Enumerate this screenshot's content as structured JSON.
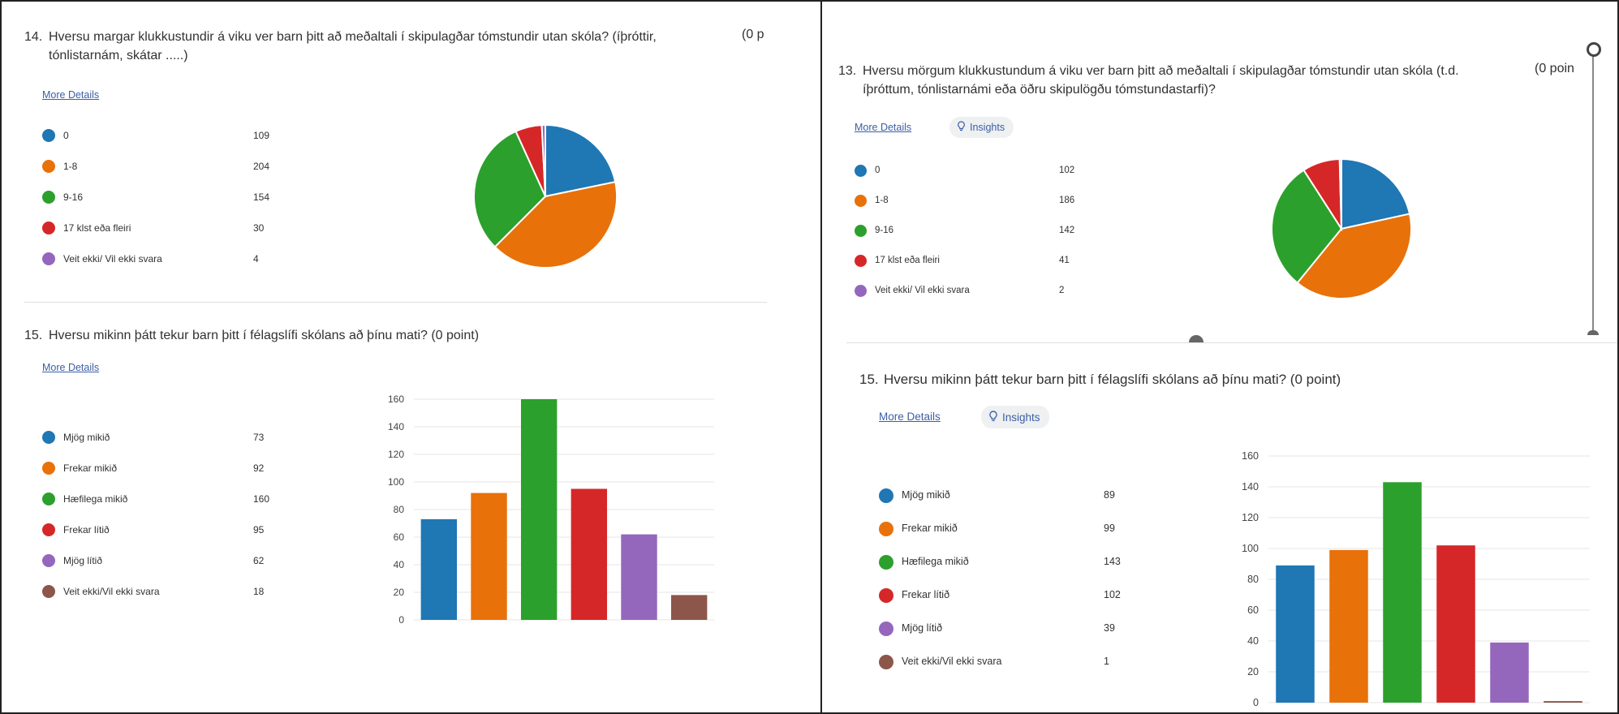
{
  "colors": {
    "blue": "#1f77b4",
    "orange": "#e8710a",
    "green": "#2ca02c",
    "red": "#d62728",
    "purple": "#9467bd",
    "brown": "#8c564b"
  },
  "left": {
    "q14": {
      "number": "14.",
      "title": "Hversu margar klukkustundir á viku ver barn þitt að meðaltali í skipulagðar tómstundir utan skóla? (íþróttir, tónlistarnám, skátar .....)",
      "points": "(0 p",
      "more_details": "More Details",
      "legend": [
        {
          "label": "0",
          "count": "109",
          "color": "#1f77b4"
        },
        {
          "label": "1-8",
          "count": "204",
          "color": "#e8710a"
        },
        {
          "label": "9-16",
          "count": "154",
          "color": "#2ca02c"
        },
        {
          "label": "17 klst eða fleiri",
          "count": "30",
          "color": "#d62728"
        },
        {
          "label": "Veit ekki/ Vil ekki svara",
          "count": "4",
          "color": "#9467bd"
        }
      ]
    },
    "q15": {
      "number": "15.",
      "title": "Hversu mikinn þátt tekur barn þitt í félagslífi skólans að þínu mati? (0 point)",
      "more_details": "More Details",
      "legend": [
        {
          "label": "Mjög mikið",
          "count": "73",
          "color": "#1f77b4"
        },
        {
          "label": "Frekar mikið",
          "count": "92",
          "color": "#e8710a"
        },
        {
          "label": "Hæfilega mikið",
          "count": "160",
          "color": "#2ca02c"
        },
        {
          "label": "Frekar lítið",
          "count": "95",
          "color": "#d62728"
        },
        {
          "label": "Mjög lítið",
          "count": "62",
          "color": "#9467bd"
        },
        {
          "label": "Veit ekki/Vil ekki svara",
          "count": "18",
          "color": "#8c564b"
        }
      ]
    }
  },
  "right": {
    "q13": {
      "number": "13.",
      "title": "Hversu mörgum klukkustundum á viku ver barn þitt að meðaltali í skipulagðar tómstundir utan skóla (t.d. íþróttum, tónlistarnámi eða öðru skipulögðu tómstundastarfi)?",
      "points": "(0 poin",
      "more_details": "More Details",
      "insights": "Insights",
      "legend": [
        {
          "label": "0",
          "count": "102",
          "color": "#1f77b4"
        },
        {
          "label": "1-8",
          "count": "186",
          "color": "#e8710a"
        },
        {
          "label": "9-16",
          "count": "142",
          "color": "#2ca02c"
        },
        {
          "label": "17 klst eða fleiri",
          "count": "41",
          "color": "#d62728"
        },
        {
          "label": "Veit ekki/ Vil ekki svara",
          "count": "2",
          "color": "#9467bd"
        }
      ]
    },
    "q15": {
      "number": "15.",
      "title": "Hversu mikinn þátt tekur barn þitt í félagslífi skólans að þínu mati? (0 point)",
      "more_details": "More Details",
      "insights": "Insights",
      "legend": [
        {
          "label": "Mjög mikið",
          "count": "89",
          "color": "#1f77b4"
        },
        {
          "label": "Frekar mikið",
          "count": "99",
          "color": "#e8710a"
        },
        {
          "label": "Hæfilega mikið",
          "count": "143",
          "color": "#2ca02c"
        },
        {
          "label": "Frekar lítið",
          "count": "102",
          "color": "#d62728"
        },
        {
          "label": "Mjög lítið",
          "count": "39",
          "color": "#9467bd"
        },
        {
          "label": "Veit ekki/Vil ekki svara",
          "count": "1",
          "color": "#8c564b"
        }
      ]
    }
  },
  "chart_data": [
    {
      "id": "left-pie",
      "type": "pie",
      "categories": [
        "0",
        "1-8",
        "9-16",
        "17 klst eða fleiri",
        "Veit ekki/ Vil ekki svara"
      ],
      "values": [
        109,
        204,
        154,
        30,
        4
      ],
      "colors": [
        "#1f77b4",
        "#e8710a",
        "#2ca02c",
        "#d62728",
        "#9467bd"
      ]
    },
    {
      "id": "left-bar",
      "type": "bar",
      "categories": [
        "Mjög mikið",
        "Frekar mikið",
        "Hæfilega mikið",
        "Frekar lítið",
        "Mjög lítið",
        "Veit ekki/Vil ekki svara"
      ],
      "values": [
        73,
        92,
        160,
        95,
        62,
        18
      ],
      "colors": [
        "#1f77b4",
        "#e8710a",
        "#2ca02c",
        "#d62728",
        "#9467bd",
        "#8c564b"
      ],
      "ylim": [
        0,
        160
      ],
      "yticks": [
        "0",
        "20",
        "40",
        "60",
        "80",
        "100",
        "120",
        "140",
        "160"
      ],
      "grid": true
    },
    {
      "id": "right-pie",
      "type": "pie",
      "categories": [
        "0",
        "1-8",
        "9-16",
        "17 klst eða fleiri",
        "Veit ekki/ Vil ekki svara"
      ],
      "values": [
        102,
        186,
        142,
        41,
        2
      ],
      "colors": [
        "#1f77b4",
        "#e8710a",
        "#2ca02c",
        "#d62728",
        "#9467bd"
      ]
    },
    {
      "id": "right-bar",
      "type": "bar",
      "categories": [
        "Mjög mikið",
        "Frekar mikið",
        "Hæfilega mikið",
        "Frekar lítið",
        "Mjög lítið",
        "Veit ekki/Vil ekki svara"
      ],
      "values": [
        89,
        99,
        143,
        102,
        39,
        1
      ],
      "colors": [
        "#1f77b4",
        "#e8710a",
        "#2ca02c",
        "#d62728",
        "#9467bd",
        "#8c564b"
      ],
      "ylim": [
        0,
        160
      ],
      "yticks": [
        "0",
        "20",
        "40",
        "60",
        "80",
        "100",
        "120",
        "140",
        "160"
      ],
      "grid": true
    }
  ]
}
